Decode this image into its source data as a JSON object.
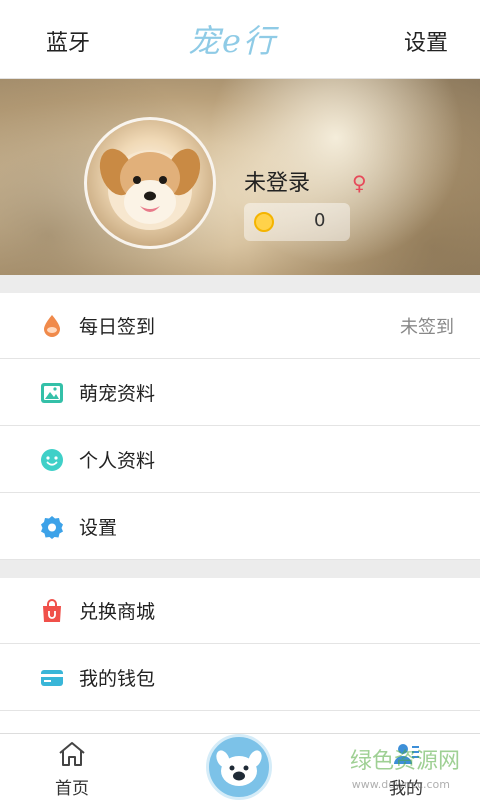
{
  "header": {
    "left": "蓝牙",
    "logo": "宠e行",
    "right": "设置"
  },
  "profile": {
    "username": "未登录",
    "gender_symbol": "♀",
    "coins": "0"
  },
  "menu1": [
    {
      "label": "每日签到",
      "extra": "未签到",
      "icon": "drop-icon",
      "color": "#f08a4b"
    },
    {
      "label": "萌宠资料",
      "icon": "image-icon",
      "color": "#34c0a8"
    },
    {
      "label": "个人资料",
      "icon": "smile-icon",
      "color": "#3fd0c8"
    },
    {
      "label": "设置",
      "icon": "gear-icon",
      "color": "#3da2e8"
    }
  ],
  "menu2": [
    {
      "label": "兑换商城",
      "icon": "shopping-bag-icon",
      "color": "#f0504a"
    },
    {
      "label": "我的钱包",
      "icon": "card-icon",
      "color": "#39b6d8"
    }
  ],
  "tabs": {
    "home": "首页",
    "mine": "我的"
  },
  "watermark": {
    "main": "绿色资源网",
    "sub": "www.downcc.com"
  }
}
